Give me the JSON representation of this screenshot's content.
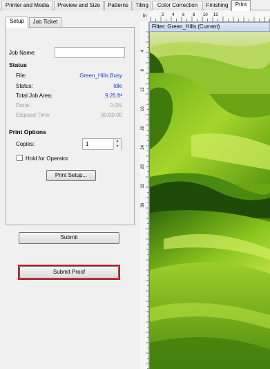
{
  "top_tabs": {
    "printer_media": "Printer and Media",
    "preview_size": "Preview and Size",
    "patterns": "Patterns",
    "tiling": "Tiling",
    "color_correction": "Color Correction",
    "finishing": "Finishing",
    "print": "Print",
    "active": "Print"
  },
  "sub_tabs": {
    "setup": "Setup",
    "job_ticket": "Job Ticket",
    "active": "Setup"
  },
  "job_name": {
    "label": "Job Name:",
    "value": ""
  },
  "status": {
    "heading": "Status",
    "file_label": "File:",
    "file_value": "Green_Hills.Busy",
    "status_label": "Status:",
    "status_value": "Idle",
    "area_label": "Total Job Area:",
    "area_value": "9.25 ft²",
    "done_label": "Done:",
    "done_value": "0.0%",
    "elapsed_label": "Elapsed Time:",
    "elapsed_value": "00:00:00"
  },
  "print_options": {
    "heading": "Print Options",
    "copies_label": "Copies:",
    "copies_value": "1",
    "hold_label": "Hold for Operator",
    "hold_checked": false,
    "print_setup_button": "Print Setup..."
  },
  "buttons": {
    "submit": "Submit",
    "submit_proof": "Submit Proof"
  },
  "ruler": {
    "unit": "in",
    "h_labels": [
      "2",
      "4",
      "6",
      "8",
      "10",
      "12"
    ],
    "v_labels": [
      "4",
      "8",
      "12",
      "16",
      "20",
      "24",
      "28",
      "32",
      "36"
    ]
  },
  "preview": {
    "title": "Filter: Green_Hills (Current)"
  },
  "colors": {
    "highlight": "#d0101e",
    "value_blue": "#1a3fd6",
    "disabled_grey": "#a0a0a0"
  }
}
